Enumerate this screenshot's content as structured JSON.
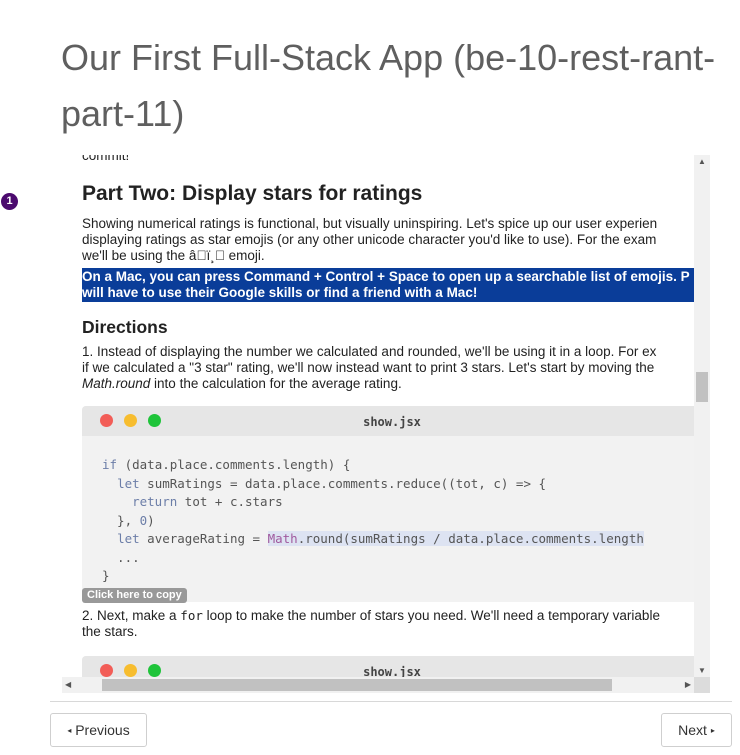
{
  "page": {
    "title": "Our First Full-Stack App (be-10-rest-rant-part-11)"
  },
  "badge": {
    "number": "1"
  },
  "content": {
    "cut_text": "commit!",
    "heading": "Part Two: Display stars for ratings",
    "para1_lines": [
      "Showing numerical ratings is functional, but visually uninspiring. Let's spice up our user experien",
      "displaying ratings as star emojis (or any other unicode character you'd like to use). For the exam",
      "we'll be using the â\u0000ï¸\u0000 emoji."
    ],
    "highlight_lines": [
      "On a Mac, you can press Command + Control + Space to open up a searchable list of emojis. P",
      "will have to use their Google skills or find a friend with a Mac!"
    ],
    "directions_heading": "Directions",
    "para3_lines": [
      "1. Instead of displaying the number we calculated and rounded, we'll be using it in a loop. For ex",
      "if we calculated a \"3 star\" rating, we'll now instead want to print 3 stars. Let's start by moving the"
    ],
    "para3_italic": "Math.round",
    "para3_tail": " into the calculation for the average rating.",
    "code1": {
      "filename": "show.jsx",
      "lines": {
        "l1_kw": "if",
        "l1_rest": " (data.place.comments.length) {",
        "l2_kw": "let",
        "l2_rest": " sumRatings = data.place.comments.reduce((tot, c) => {",
        "l3_kw": "return",
        "l3_rest": " tot + c.stars",
        "l4_start": "  }, ",
        "l4_num": "0",
        "l4_end": ")",
        "l5_kw": "let",
        "l5_mid": " averageRating = ",
        "l5_math": "Math",
        "l5_sel": ".round(sumRatings / data.place.comments.length",
        "l6": "  ...",
        "l7": "}"
      }
    },
    "copy_label": "Click here to copy",
    "para4_line1_a": "2. Next, make a ",
    "para4_code": "for",
    "para4_line1_b": " loop to make the number of stars you need. We'll need a temporary variable",
    "para4_line2": "the stars.",
    "code2": {
      "filename": "show.jsx"
    }
  },
  "scroll": {
    "up": "▲",
    "down": "▼",
    "left": "◀",
    "right": "▶"
  },
  "nav": {
    "prev_label": "Previous",
    "next_label": "Next",
    "prev_arrow": "◂",
    "next_arrow": "▸"
  }
}
